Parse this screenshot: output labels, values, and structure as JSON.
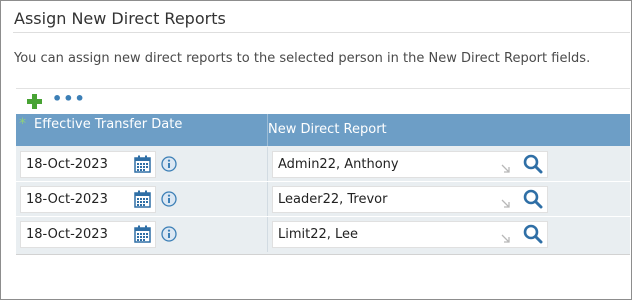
{
  "page": {
    "title": "Assign New Direct Reports",
    "description": "You can assign new direct reports to the selected person in the New Direct Report fields."
  },
  "toolbar": {
    "add_icon": "plus-icon",
    "more_icon": "ellipsis-icon",
    "more_label": "•••"
  },
  "table": {
    "required_mark": "*",
    "columns": [
      "Effective Transfer Date",
      "New Direct Report"
    ],
    "rows": [
      {
        "date": "18-Oct-2023",
        "report": "Admin22, Anthony"
      },
      {
        "date": "18-Oct-2023",
        "report": "Leader22, Trevor"
      },
      {
        "date": "18-Oct-2023",
        "report": "Limit22, Lee"
      }
    ]
  },
  "colors": {
    "header_bg": "#6d9ec6",
    "add_green": "#48a334",
    "icon_blue": "#3c7fb6",
    "row_bg": "#e9eef1"
  }
}
